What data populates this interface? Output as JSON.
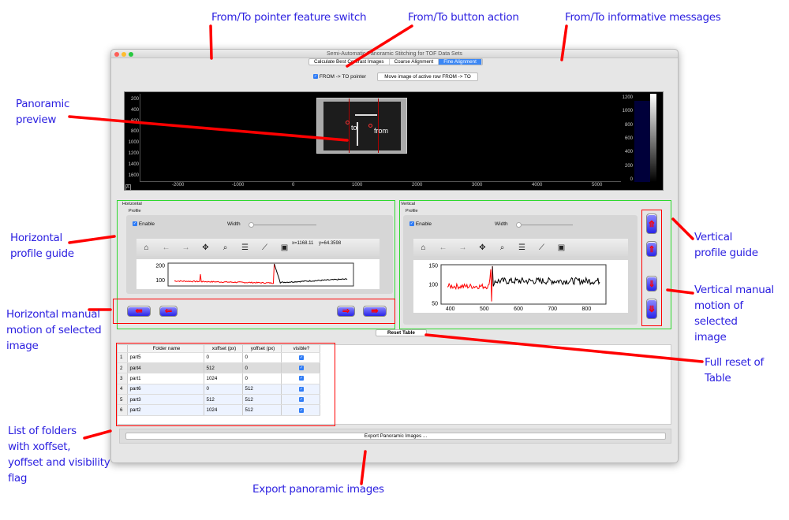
{
  "window": {
    "title": "Semi-Automatic Panoramic Stitching for TOF Data Sets",
    "tabs": [
      {
        "label": "Calculate Best Contrast Images",
        "active": false
      },
      {
        "label": "Coarse Alignment",
        "active": false
      },
      {
        "label": "Fine Alignment",
        "active": true
      }
    ],
    "from_to_checkbox": {
      "label": "FROM -> TO pointer",
      "checked": true
    },
    "move_button": "Move image of active row FROM -> TO",
    "preview": {
      "y_ticks": [
        "200",
        "400",
        "600",
        "800",
        "1000",
        "1200",
        "1400",
        "1600"
      ],
      "x_ticks": [
        "-2000",
        "-1000",
        "0",
        "1000",
        "2000",
        "3000",
        "4000",
        "5000"
      ],
      "colorbar_ticks": [
        "1200",
        "1000",
        "800",
        "600",
        "400",
        "200",
        "0"
      ],
      "corner": "A",
      "marker_to": "to",
      "marker_from": "from"
    },
    "horizontal": {
      "group": "Horizontal",
      "profile": "Profile",
      "enable": "Enable",
      "enabled": true,
      "width": "Width",
      "coords": {
        "x": "x=1168.11",
        "y": "y=64.3598"
      },
      "y_ticks": [
        "200",
        "100"
      ]
    },
    "vertical": {
      "group": "Vertical",
      "profile": "Profile",
      "enable": "Enable",
      "enabled": true,
      "width": "Width",
      "y_ticks": [
        "150",
        "100",
        "50"
      ],
      "x_ticks": [
        "400",
        "500",
        "600",
        "700",
        "800"
      ]
    },
    "toolbar_icons": [
      "home-icon",
      "back-icon",
      "forward-icon",
      "pan-icon",
      "zoom-icon",
      "configure-icon",
      "edit-curve-icon",
      "save-icon"
    ],
    "reset_table": "Reset Table",
    "table": {
      "headers": [
        "Folder name",
        "xoffset (px)",
        "yoffset (px)",
        "visible?"
      ],
      "rows": [
        [
          "1",
          "part5",
          "0",
          "0",
          true
        ],
        [
          "2",
          "part4",
          "512",
          "0",
          true
        ],
        [
          "3",
          "part1",
          "1024",
          "0",
          true
        ],
        [
          "4",
          "part6",
          "0",
          "512",
          true
        ],
        [
          "5",
          "part3",
          "512",
          "512",
          true
        ],
        [
          "6",
          "part2",
          "1024",
          "512",
          true
        ]
      ]
    },
    "export_button": "Export Panoramic Images ...",
    "colors": {
      "profile_before": "#ff0000",
      "profile_after": "#000000",
      "group_border": "#2ed82e",
      "annotation": "#2b1fe0",
      "highlight": "#ff0000"
    }
  },
  "annotations": {
    "pointer_switch": "From/To pointer feature switch",
    "button_action": "From/To button action",
    "messages": "From/To informative messages",
    "preview": [
      "Panoramic",
      "preview"
    ],
    "hguide": [
      "Horizontal",
      "profile guide"
    ],
    "hmotion": [
      "Horizontal manual",
      "motion of selected",
      "image"
    ],
    "folders": [
      "List of folders",
      "with xoffset,",
      "yoffset and visibility",
      "flag"
    ],
    "export": "Export panoramic images",
    "vguide": [
      "Vertical",
      "profile guide"
    ],
    "vmotion": [
      "Vertical manual",
      "motion of selected",
      "image"
    ],
    "reset": [
      "Full reset of",
      "Table"
    ]
  }
}
